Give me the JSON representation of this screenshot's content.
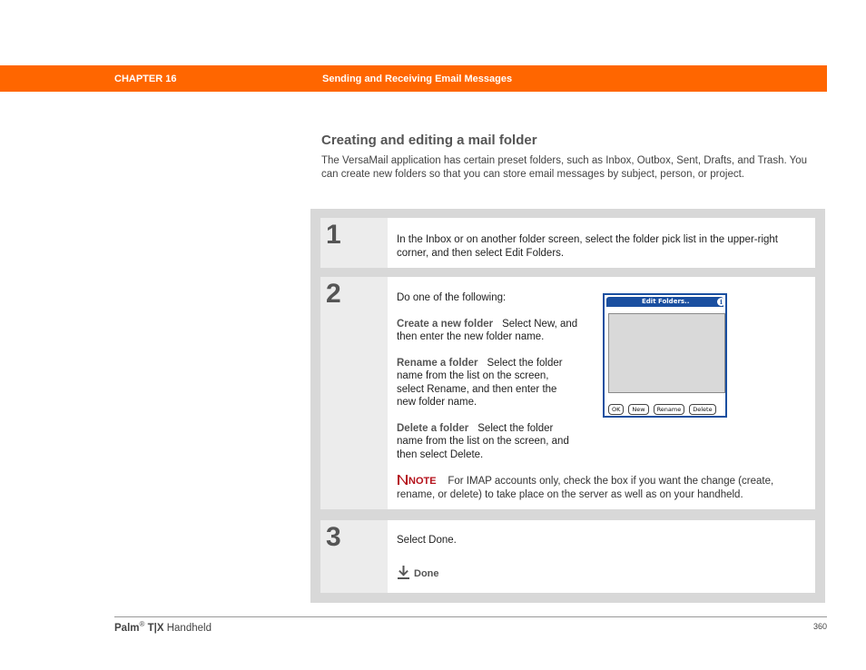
{
  "header": {
    "chapter": "CHAPTER 16",
    "title": "Sending and Receiving Email Messages"
  },
  "section": {
    "heading": "Creating and editing a mail folder",
    "intro": "The VersaMail application has certain preset folders, such as Inbox, Outbox, Sent, Drafts, and Trash. You can create new folders so that you can store email messages by subject, person, or project."
  },
  "steps": [
    {
      "number": "1",
      "text": "In the Inbox or on another folder screen, select the folder pick list in the upper-right corner, and then select Edit Folders."
    },
    {
      "number": "2",
      "lead": "Do one of the following:",
      "options": [
        {
          "label": "Create a new folder",
          "text": "Select New, and then enter the new folder name."
        },
        {
          "label": "Rename a folder",
          "text": "Select the folder name from the list on the screen, select Rename, and then enter the new folder name."
        },
        {
          "label": "Delete a folder",
          "text": "Select the folder name from the list on the screen, and then select Delete."
        }
      ],
      "note_label": "NOTE",
      "note_text": "For IMAP accounts only, check the box if you want the change (create, rename, or delete) to take place on the server as well as on your handheld.",
      "screen": {
        "title": "Edit Folders..",
        "buttons": [
          "OK",
          "New",
          "Rename",
          "Delete"
        ]
      }
    },
    {
      "number": "3",
      "text": "Select Done.",
      "done_label": "Done"
    }
  ],
  "footer": {
    "brand": "Palm",
    "reg": "®",
    "model": "T|X",
    "product": "Handheld",
    "page": "360"
  },
  "colors": {
    "accent": "#ff6600",
    "palm_blue": "#1a4fa0",
    "note_red": "#b5121b"
  }
}
